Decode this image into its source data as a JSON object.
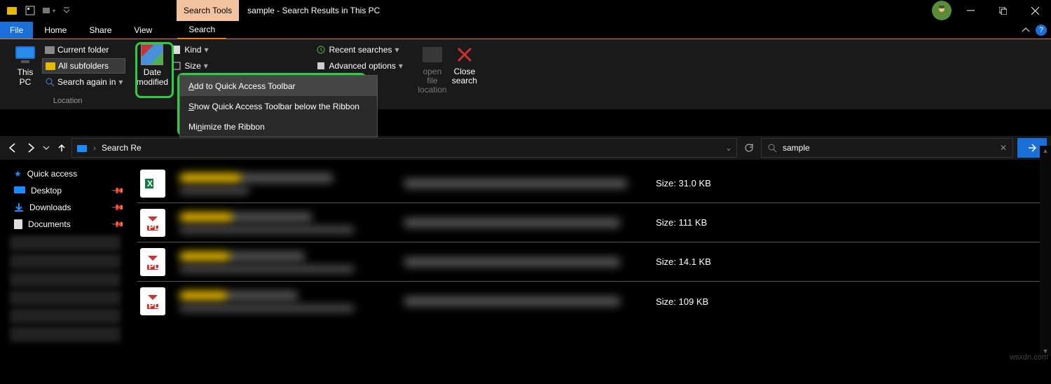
{
  "titlebar": {
    "tool_tab": "Search Tools",
    "title": "sample - Search Results in This PC"
  },
  "menu": {
    "file": "File",
    "home": "Home",
    "share": "Share",
    "view": "View",
    "search": "Search"
  },
  "ribbon": {
    "this_pc": "This PC",
    "current_folder": "Current folder",
    "all_subfolders": "All subfolders",
    "search_again": "Search again in",
    "location_label": "Location",
    "date_modified": "Date modified",
    "kind": "Kind",
    "size": "Size",
    "recent": "Recent searches",
    "advanced": "Advanced options",
    "open_loc": "open file location",
    "close": "Close search"
  },
  "context": {
    "add": "Add to Quick Access Toolbar",
    "show": "Show Quick Access Toolbar below the Ribbon",
    "min": "Minimize the Ribbon"
  },
  "nav": {
    "breadcrumb": "Search Re",
    "search_value": "sample"
  },
  "sidebar": {
    "quick": "Quick access",
    "desktop": "Desktop",
    "downloads": "Downloads",
    "documents": "Documents"
  },
  "results": [
    {
      "type": "xl",
      "size": "Size: 31.0 KB"
    },
    {
      "type": "pdf",
      "size": "Size: 111 KB"
    },
    {
      "type": "pdf",
      "size": "Size: 14.1 KB"
    },
    {
      "type": "pdf",
      "size": "Size: 109 KB"
    }
  ],
  "watermark": "wsxdn.com"
}
